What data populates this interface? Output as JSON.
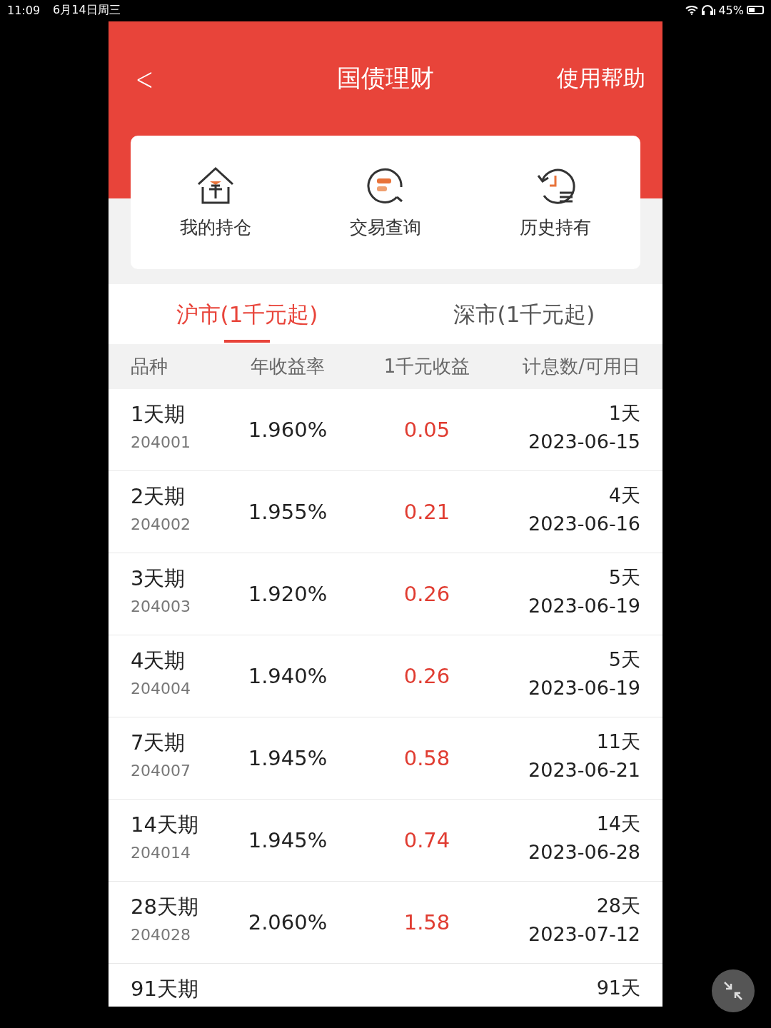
{
  "status_bar": {
    "time": "11:09",
    "date": "6月14日周三",
    "battery": "45%"
  },
  "header": {
    "back": "<",
    "title": "国债理财",
    "help": "使用帮助"
  },
  "shortcuts": [
    {
      "kind": "holdings",
      "label": "我的持仓"
    },
    {
      "kind": "query",
      "label": "交易查询"
    },
    {
      "kind": "history",
      "label": "历史持有"
    }
  ],
  "tabs": [
    {
      "label": "沪市(1千元起)",
      "selected": true
    },
    {
      "label": "深市(1千元起)",
      "selected": false
    }
  ],
  "table": {
    "columns": [
      "品种",
      "年收益率",
      "1千元收益",
      "计息数/可用日"
    ],
    "rows": [
      {
        "name": "1天期",
        "code": "204001",
        "rate": "1.960%",
        "income": "0.05",
        "days": "1天",
        "date": "2023-06-15"
      },
      {
        "name": "2天期",
        "code": "204002",
        "rate": "1.955%",
        "income": "0.21",
        "days": "4天",
        "date": "2023-06-16"
      },
      {
        "name": "3天期",
        "code": "204003",
        "rate": "1.920%",
        "income": "0.26",
        "days": "5天",
        "date": "2023-06-19"
      },
      {
        "name": "4天期",
        "code": "204004",
        "rate": "1.940%",
        "income": "0.26",
        "days": "5天",
        "date": "2023-06-19"
      },
      {
        "name": "7天期",
        "code": "204007",
        "rate": "1.945%",
        "income": "0.58",
        "days": "11天",
        "date": "2023-06-21"
      },
      {
        "name": "14天期",
        "code": "204014",
        "rate": "1.945%",
        "income": "0.74",
        "days": "14天",
        "date": "2023-06-28"
      },
      {
        "name": "28天期",
        "code": "204028",
        "rate": "2.060%",
        "income": "1.58",
        "days": "28天",
        "date": "2023-07-12"
      },
      {
        "name": "91天期",
        "days": "91天"
      }
    ]
  }
}
